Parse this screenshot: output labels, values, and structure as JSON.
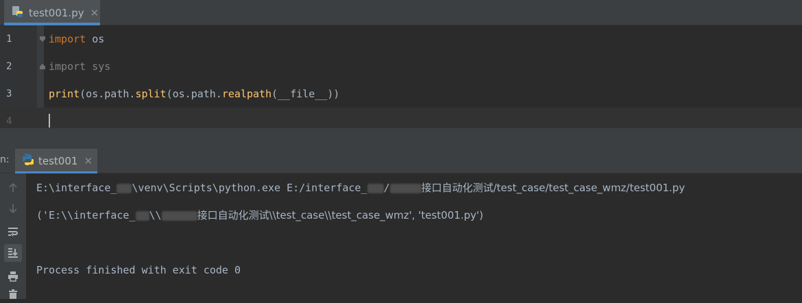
{
  "editor_tab": {
    "filename": "test001.py",
    "close": "✕"
  },
  "editor": {
    "lines": [
      {
        "num": "1",
        "kw": "import",
        "rest": " os"
      },
      {
        "num": "2",
        "kw": "import",
        "rest": " sys"
      },
      {
        "num": "3",
        "fn": "print",
        "p1": "(os.path.",
        "fn2": "split",
        "p2": "(os.path.",
        "fn3": "realpath",
        "p3": "(__file__))"
      },
      {
        "num": "4"
      }
    ]
  },
  "run_panel": {
    "prefix": "n:",
    "tab_label": "test001",
    "tab_close": "✕",
    "toolbar_icons": [
      "arrow-up-icon",
      "arrow-down-icon",
      "soft-wrap-icon",
      "scroll-to-end-icon",
      "print-icon",
      "trash-icon"
    ],
    "output": {
      "line1_a": "E:\\interface_",
      "line1_b": "\\venv\\Scripts\\python.exe E:/interface_",
      "line1_c": "/",
      "line1_d": "接口自动化测试/test_case/test_case_wmz/test001.py",
      "line2_a": "('E:\\\\interface_",
      "line2_b": "\\\\",
      "line2_c": "接口自动化测试\\\\test_case\\\\test_case_wmz', 'test001.py')",
      "line3": "Process finished with exit code 0"
    }
  },
  "colors": {
    "keyword": "#cc7832",
    "function": "#ffc66d",
    "text": "#a9b7c6",
    "unused": "#808080",
    "accent": "#4a88c7"
  }
}
